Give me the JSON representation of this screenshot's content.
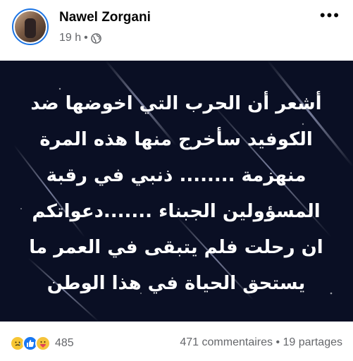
{
  "post": {
    "author": "Nawel Zorgani",
    "time": "19 h",
    "separator": "•",
    "text_lines": [
      "أشعر أن الحرب التي اخوضها ضد",
      "الكوفيد سأخرج منها هذه المرة",
      "منهزمة ........ ذنبي في رقبة",
      "المسؤولين الجبناء .......دعواتكم",
      "ان رحلت فلم يتبقى في العمر ما",
      "يستحق الحياة في هذا الوطن"
    ]
  },
  "footer": {
    "reaction_count": "485",
    "stats": "471 commentaires • 19 partages"
  },
  "icons": [
    "globe-icon",
    "more-options-icon",
    "sad-reaction-icon",
    "like-reaction-icon",
    "care-reaction-icon"
  ],
  "colors": {
    "image_background": "#0a0f24",
    "text": "#ffffff",
    "avatar_ring": "#1b74e4",
    "muted": "#65676b",
    "like_blue": "#1877f2"
  }
}
